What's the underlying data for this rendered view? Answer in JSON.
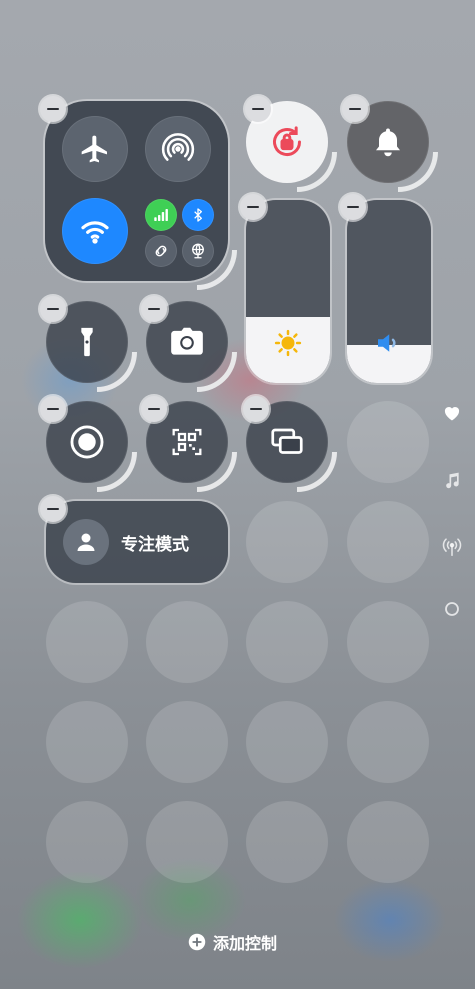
{
  "focus_tile": {
    "label": "专注模式"
  },
  "footer": {
    "add_control_label": "添加控制"
  },
  "colors": {
    "wifi_active": "#1e88ff",
    "bluetooth_active": "#1e88ff",
    "cellular_active": "#3fcf55",
    "brightness_icon": "#f5b70b",
    "volume_icon": "#2f8df0"
  },
  "sliders": {
    "brightness_level": 0.36,
    "volume_level": 0.21
  },
  "icons": [
    "airplane-mode-icon",
    "airdrop-icon",
    "wifi-icon",
    "cellular-data-icon",
    "bluetooth-icon",
    "personal-hotspot-icon",
    "vpn-icon",
    "orientation-lock-icon",
    "bell-icon",
    "brightness-icon",
    "volume-icon",
    "flashlight-icon",
    "camera-icon",
    "screen-record-icon",
    "qr-code-scanner-icon",
    "screen-mirroring-icon",
    "person-icon",
    "heart-icon",
    "music-note-icon",
    "radio-icon",
    "ring-icon",
    "plus-icon"
  ]
}
